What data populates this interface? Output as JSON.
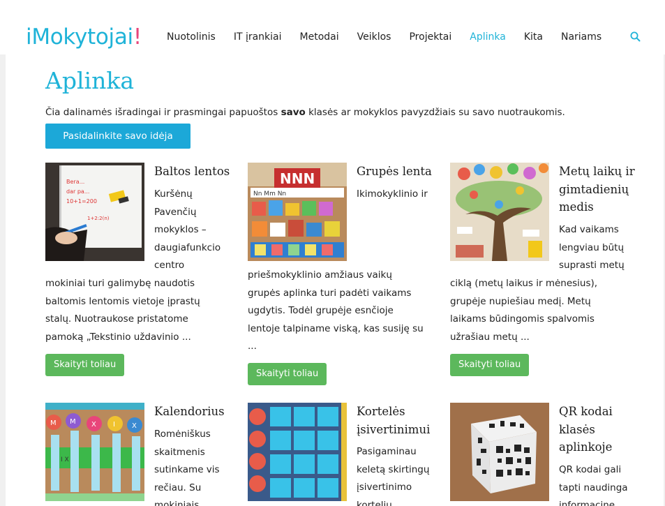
{
  "header": {
    "logo_part1": "iMokytojai",
    "logo_part2": "!",
    "nav": [
      {
        "label": "Nuotolinis"
      },
      {
        "label": "IT įrankiai"
      },
      {
        "label": "Metodai"
      },
      {
        "label": "Veiklos"
      },
      {
        "label": "Projektai"
      },
      {
        "label": "Aplinka",
        "active": true
      },
      {
        "label": "Kita"
      },
      {
        "label": "Nariams"
      }
    ],
    "search_icon": "search-icon"
  },
  "page": {
    "title": "Aplinka",
    "intro_before": "Čia dalinamės išradingai ir prasmingai papuoštos ",
    "intro_bold": "savo",
    "intro_after": " klasės ar mokyklos pavyzdžiais su savo nuotraukomis.",
    "share_button": "Pasidalinkite savo idėja"
  },
  "cards": [
    {
      "title_lines": [
        "Baltos lentos"
      ],
      "side_lines": [
        "Kuršėnų",
        "Pavenčių",
        "mokyklos –",
        "daugiafunkcio",
        "centro"
      ],
      "full_lines": [
        "mokiniai turi galimybę naudotis",
        "baltomis lentomis vietoje įprastų",
        "stalų. Nuotraukose pristatome",
        "pamoką „Tekstinio uždavinio ..."
      ],
      "read_more": "Skaityti toliau"
    },
    {
      "title_lines": [
        "Grupės lenta"
      ],
      "side_lines": [
        "Ikimokyklinio ir"
      ],
      "full_lines": [
        "priešmokyklinio amžiaus vaikų",
        "grupės aplinka turi padėti vaikams",
        "ugdytis. Todėl grupėje esnčioje",
        "lentoje talpiname viską, kas susiję su",
        "..."
      ],
      "read_more": "Skaityti toliau"
    },
    {
      "title_lines": [
        "Metų laikų ir",
        "gimtadienių",
        "medis"
      ],
      "side_lines": [
        "Kad vaikams",
        "lengviau būtų",
        "suprasti metų"
      ],
      "full_lines": [
        "ciklą (metų laikus ir mėnesius),",
        "grupėje nupiešiau medį. Metų",
        "laikams būdingomis spalvomis",
        "užrašiau metų ..."
      ],
      "read_more": "Skaityti toliau"
    },
    {
      "title_lines": [
        "Kalendorius"
      ],
      "side_lines": [
        "Romėniškus",
        "skaitmenis",
        "sutinkame vis",
        "rečiau. Su",
        "mokiniais"
      ],
      "full_lines": [],
      "read_more": ""
    },
    {
      "title_lines": [
        "Kortelės",
        "įsivertinimui"
      ],
      "side_lines": [
        "Pasigaminau",
        "keletą skirtingų",
        "įsivertinimo",
        "kortelių"
      ],
      "full_lines": [],
      "read_more": ""
    },
    {
      "title_lines": [
        "QR kodai",
        "klasės",
        "aplinkoje"
      ],
      "side_lines": [
        "QR kodai gali",
        "tapti naudinga",
        "informacine"
      ],
      "full_lines": [],
      "read_more": ""
    }
  ]
}
